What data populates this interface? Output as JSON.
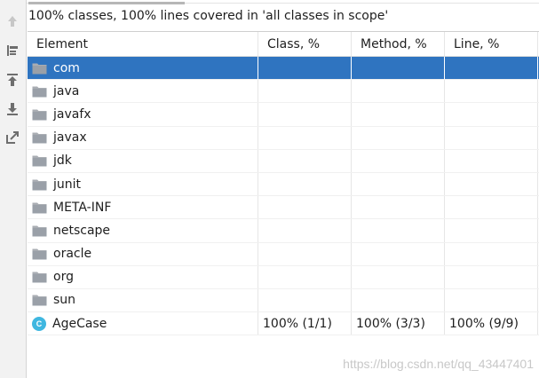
{
  "summary": "100% classes, 100% lines covered in 'all classes in scope'",
  "toolbar": {
    "buttons": [
      {
        "name": "scroll-up-icon"
      },
      {
        "name": "flatten-packages-icon"
      },
      {
        "name": "export-icon"
      },
      {
        "name": "import-icon"
      },
      {
        "name": "navigate-icon"
      }
    ]
  },
  "table": {
    "columns": [
      "Element",
      "Class, %",
      "Method, %",
      "Line, %"
    ],
    "rows": [
      {
        "name": "com",
        "type": "folder",
        "class_pct": "",
        "method_pct": "",
        "line_pct": "",
        "selected": true
      },
      {
        "name": "java",
        "type": "folder",
        "class_pct": "",
        "method_pct": "",
        "line_pct": ""
      },
      {
        "name": "javafx",
        "type": "folder",
        "class_pct": "",
        "method_pct": "",
        "line_pct": ""
      },
      {
        "name": "javax",
        "type": "folder",
        "class_pct": "",
        "method_pct": "",
        "line_pct": ""
      },
      {
        "name": "jdk",
        "type": "folder",
        "class_pct": "",
        "method_pct": "",
        "line_pct": ""
      },
      {
        "name": "junit",
        "type": "folder",
        "class_pct": "",
        "method_pct": "",
        "line_pct": ""
      },
      {
        "name": "META-INF",
        "type": "folder",
        "class_pct": "",
        "method_pct": "",
        "line_pct": ""
      },
      {
        "name": "netscape",
        "type": "folder",
        "class_pct": "",
        "method_pct": "",
        "line_pct": ""
      },
      {
        "name": "oracle",
        "type": "folder",
        "class_pct": "",
        "method_pct": "",
        "line_pct": ""
      },
      {
        "name": "org",
        "type": "folder",
        "class_pct": "",
        "method_pct": "",
        "line_pct": ""
      },
      {
        "name": "sun",
        "type": "folder",
        "class_pct": "",
        "method_pct": "",
        "line_pct": ""
      },
      {
        "name": "AgeCase",
        "type": "class",
        "class_pct": "100% (1/1)",
        "method_pct": "100% (3/3)",
        "line_pct": "100% (9/9)"
      }
    ],
    "class_icon_letter": "C"
  },
  "watermark": "https://blog.csdn.net/qq_43447401",
  "colors": {
    "selection": "#2f74c0",
    "folder": "#a9adb3",
    "class_icon": "#3fb7e0"
  }
}
